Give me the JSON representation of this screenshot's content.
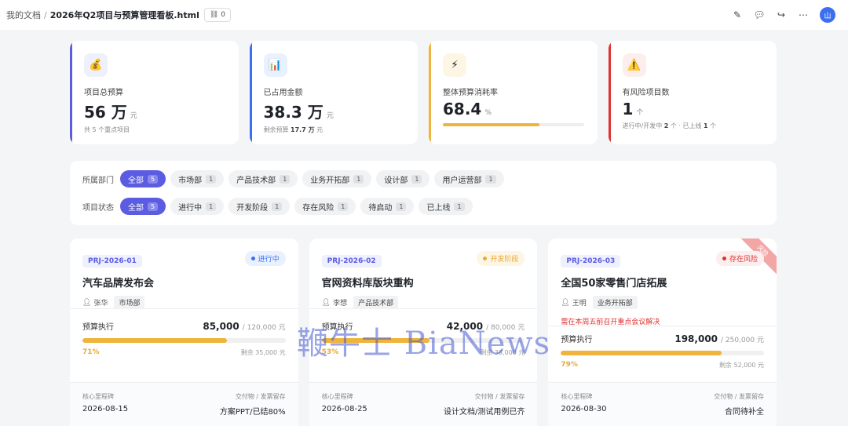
{
  "topbar": {
    "crumb": "我的文档",
    "title": "2026年Q2项目与预算管理看板.html",
    "share_count": "0",
    "avatar": "山",
    "icons": [
      "edit-icon",
      "comment-icon",
      "share-icon",
      "more-icon"
    ]
  },
  "kpis": [
    {
      "icon": "money-bag-icon",
      "glyph": "💰",
      "label": "项目总预算",
      "value": "56 万",
      "unit": "元",
      "sub": "共 5 个重点项目",
      "accent": "#5b5ce2",
      "icon_bg": "#eef0fd"
    },
    {
      "icon": "bar-chart-icon",
      "glyph": "📊",
      "label": "已占用金额",
      "value": "38.3 万",
      "unit": "元",
      "sub_prefix": "剩余预算 ",
      "sub_strong": "17.7 万",
      "sub_suffix": " 元",
      "accent": "#3b6ff0",
      "icon_bg": "#eaf1fe"
    },
    {
      "icon": "lightning-icon",
      "glyph": "⚡",
      "label": "整体预算消耗率",
      "value": "68.4",
      "unit": "%",
      "progress": 0.684,
      "accent": "#f0b43c",
      "icon_bg": "#fdf6e4"
    },
    {
      "icon": "warning-icon",
      "glyph": "⚠️",
      "label": "有风险项目数",
      "value": "1",
      "unit": "个",
      "sub_a": "进行中/开发中 ",
      "sub_a_strong": "2",
      "sub_b": " 个 · 已上线 ",
      "sub_b_strong": "1",
      "sub_c": " 个",
      "accent": "#e03131",
      "icon_bg": "#fdeeee"
    }
  ],
  "filters": {
    "dept_label": "所属部门",
    "dept": [
      {
        "label": "全部",
        "count": "5",
        "active": true
      },
      {
        "label": "市场部",
        "count": "1"
      },
      {
        "label": "产品技术部",
        "count": "1"
      },
      {
        "label": "业务开拓部",
        "count": "1"
      },
      {
        "label": "设计部",
        "count": "1"
      },
      {
        "label": "用户运营部",
        "count": "1"
      }
    ],
    "status_label": "项目状态",
    "status": [
      {
        "label": "全部",
        "count": "5",
        "active": true
      },
      {
        "label": "进行中",
        "count": "1"
      },
      {
        "label": "开发阶段",
        "count": "1"
      },
      {
        "label": "存在风险",
        "count": "1"
      },
      {
        "label": "待启动",
        "count": "1"
      },
      {
        "label": "已上线",
        "count": "1"
      }
    ]
  },
  "projects": [
    {
      "code": "PRJ-2026-01",
      "status": "进行中",
      "status_color": "#3b6ff0",
      "status_bg": "#eaf1fe",
      "name": "汽车品牌发布会",
      "owner": "张华",
      "dept": "市场部",
      "budget_label": "预算执行",
      "used": "85,000",
      "total": "120,000 元",
      "progress": 0.71,
      "pct": "71%",
      "remain": "剩余 35,000 元",
      "milestone_label": "核心里程碑",
      "milestone": "2026-08-15",
      "deliverable_label": "交付物 / 发票留存",
      "deliverable": "方案PPT/已结80%"
    },
    {
      "code": "PRJ-2026-02",
      "status": "开发阶段",
      "status_color": "#e8a93a",
      "status_bg": "#fdf6e4",
      "name": "官网资料库版块重构",
      "owner": "李想",
      "dept": "产品技术部",
      "budget_label": "预算执行",
      "used": "42,000",
      "total": "80,000 元",
      "progress": 0.53,
      "pct": "53%",
      "remain": "剩余 38,000 元",
      "milestone_label": "核心里程碑",
      "milestone": "2026-08-25",
      "deliverable_label": "交付物 / 发票留存",
      "deliverable": "设计文档/测试用例已齐"
    },
    {
      "code": "PRJ-2026-03",
      "status": "存在风险",
      "status_color": "#e03131",
      "status_bg": "#fdeeee",
      "ribbon": "风险",
      "name": "全国50家零售门店拓展",
      "owner": "王明",
      "dept": "业务开拓部",
      "risk_note": "需在本周五前召开重点会议解决",
      "budget_label": "预算执行",
      "used": "198,000",
      "total": "250,000 元",
      "progress": 0.79,
      "pct": "79%",
      "remain": "剩余 52,000 元",
      "milestone_label": "核心里程碑",
      "milestone": "2026-08-30",
      "deliverable_label": "交付物 / 发票留存",
      "deliverable": "合同待补全"
    }
  ],
  "watermark": "鞭牛士 BiaNews"
}
